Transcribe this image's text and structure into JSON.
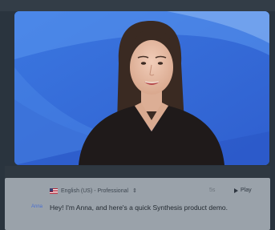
{
  "editor": {
    "language": "English (US) - Professional",
    "separator": "5s",
    "play_label": "Play",
    "speaker": "Anna",
    "script_text": "Hey! I'm Anna, and here's a quick Synthesis product demo."
  },
  "colors": {
    "background_blue": "#3a6fd8",
    "editor_gray": "#9aa2aa",
    "dark_frame": "#2a343e"
  }
}
